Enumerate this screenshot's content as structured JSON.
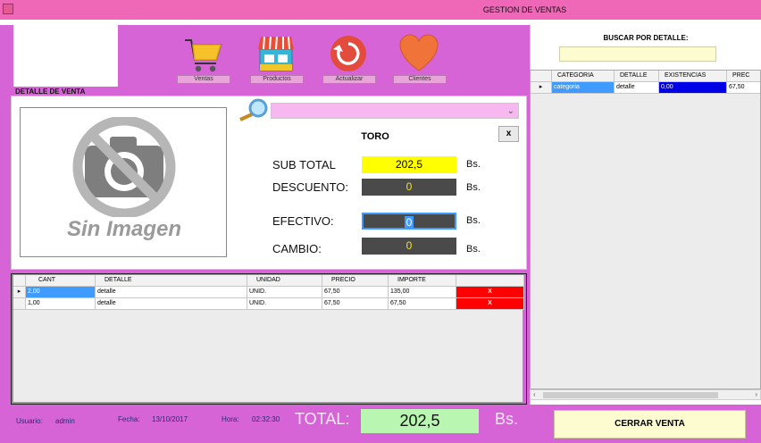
{
  "window": {
    "title": "GESTION DE VENTAS"
  },
  "toolbar": {
    "ventas_label": "Ventas",
    "productos_label": "Productos",
    "actualizar_label": "Actualizar",
    "clientes_label": "Clientes"
  },
  "detalle": {
    "section_label": "DETALLE DE VENTA",
    "no_image_text": "Sin Imagen",
    "product_name": "TORO",
    "close_label": "x",
    "subtotal_label": "SUB TOTAL",
    "subtotal_value": "202,5",
    "descuento_label": "DESCUENTO:",
    "descuento_value": "0",
    "efectivo_label": "EFECTIVO:",
    "efectivo_value": "0",
    "cambio_label": "CAMBIO:",
    "cambio_value": "0",
    "currency": "Bs."
  },
  "sale_grid": {
    "headers": [
      "CANT",
      "DETALLE",
      "UNIDAD",
      "PRECIO",
      "IMPORTE"
    ],
    "rows": [
      {
        "cant": "2,00",
        "detalle": "detalle",
        "unidad": "UNID.",
        "precio": "67,50",
        "importe": "135,00",
        "delete": "X"
      },
      {
        "cant": "1,00",
        "detalle": "detalle",
        "unidad": "UNID.",
        "precio": "67,50",
        "importe": "67,50",
        "delete": "X"
      }
    ]
  },
  "search": {
    "label": "BUSCAR POR DETALLE:",
    "value": "",
    "headers": [
      "CATEGORIA",
      "DETALLE",
      "EXISTENCIAS",
      "PREC"
    ],
    "rows": [
      {
        "categoria": "categoria",
        "detalle": "detalle",
        "existencias": "0,00",
        "precio": "67,50"
      }
    ]
  },
  "status": {
    "usuario_label": "Usuario:",
    "usuario_value": "admin",
    "fecha_label": "Fecha:",
    "fecha_value": "13/10/2017",
    "hora_label": "Hora:",
    "hora_value": "02:32:30",
    "total_label": "TOTAL:",
    "total_value": "202,5",
    "total_unit": "Bs."
  },
  "actions": {
    "cerrar_label": "CERRAR VENTA"
  },
  "colors": {
    "background": "#d764d6",
    "titlebar": "#ef67b7",
    "subtotal_bg": "#ffff00",
    "dark_field": "#4a4a4a",
    "field_value": "#f0e030",
    "delete_bg": "#ff0000",
    "selected_cell": "#3f9bff",
    "total_bg": "#b9f6b2",
    "cerrar_bg": "#fdfbd0"
  }
}
